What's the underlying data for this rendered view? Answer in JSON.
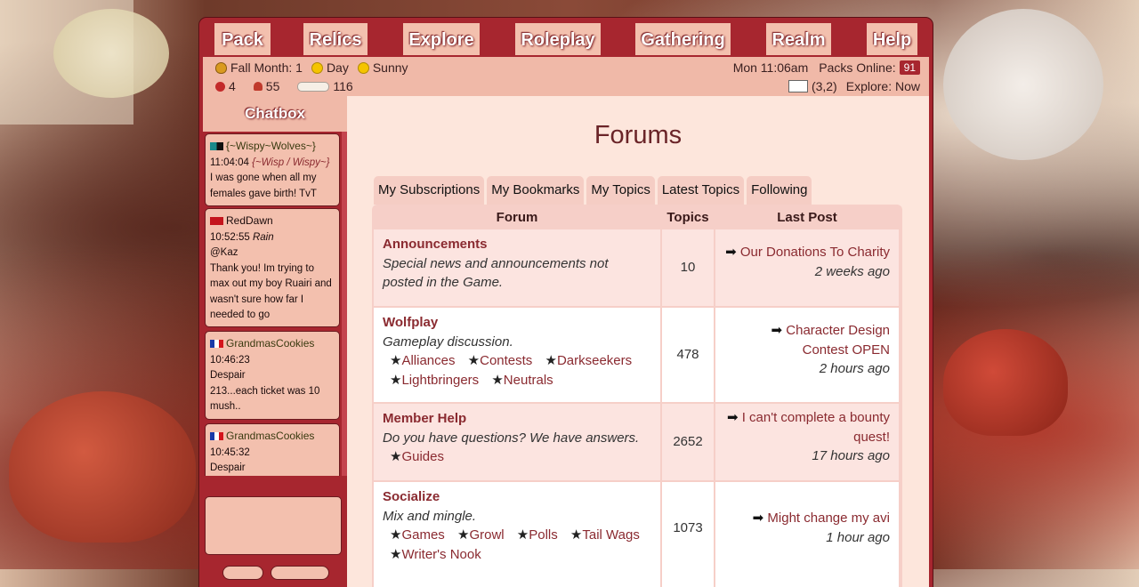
{
  "nav": [
    "Pack",
    "Relics",
    "Explore",
    "Roleplay",
    "Gathering",
    "Realm",
    "Help"
  ],
  "status": {
    "season": "Fall Month: 1",
    "time_of_day": "Day",
    "weather": "Sunny",
    "clock": "Mon 11:06am",
    "packs_online_label": "Packs Online:",
    "packs_online_count": "91",
    "hearts": "4",
    "mushrooms": "55",
    "bones": "116",
    "coords": "(3,2)",
    "explore_label": "Explore: Now"
  },
  "chat": {
    "header": "Chatbox",
    "messages": [
      {
        "user": "{~Wispy~Wolves~}",
        "time": "11:04:04",
        "alias": "{~Wisp / Wispy~}",
        "lines": [
          "I was gone when all my",
          "females gave birth! TvT"
        ]
      },
      {
        "user": "RedDawn",
        "time": "10:52:55",
        "alias": "Rain",
        "lines": [
          "@Kaz",
          "Thank you! Im trying to",
          "max out my boy Ruairi and",
          "wasn't sure how far I",
          "needed to go"
        ]
      },
      {
        "user": "GrandmasCookies",
        "time": "10:46:23",
        "alias": "",
        "lines": [
          "Despair",
          "213...each ticket was 10",
          "mush.."
        ]
      },
      {
        "user": "GrandmasCookies",
        "time": "10:45:32",
        "alias": "",
        "lines": [
          "Despair"
        ]
      }
    ]
  },
  "page": {
    "title": "Forums",
    "tabs": [
      "My Subscriptions",
      "My Bookmarks",
      "My Topics",
      "Latest Topics",
      "Following"
    ],
    "columns": [
      "Forum",
      "Topics",
      "Last Post"
    ],
    "forums": [
      {
        "name": "Announcements",
        "desc": "Special news and announcements not posted in the Game.",
        "subs": [],
        "topics": "10",
        "last_post": "Our Donations To Charity",
        "ago": "2 weeks ago"
      },
      {
        "name": "Wolfplay",
        "desc": "Gameplay discussion.",
        "subs": [
          "Alliances",
          "Contests",
          "Darkseekers",
          "Lightbringers",
          "Neutrals"
        ],
        "topics": "478",
        "last_post": "Character Design Contest OPEN",
        "ago": "2 hours ago"
      },
      {
        "name": "Member Help",
        "desc": "Do you have questions? We have answers.",
        "subs": [
          "Guides"
        ],
        "topics": "2652",
        "last_post": "I can't complete a bounty quest!",
        "ago": "17 hours ago"
      },
      {
        "name": "Socialize",
        "desc": "Mix and mingle.",
        "subs": [
          "Games",
          "Growl",
          "Polls",
          "Tail Wags",
          "Writer's Nook"
        ],
        "topics": "1073",
        "last_post": "Might change my avi",
        "ago": "1 hour ago"
      }
    ]
  },
  "colors": {
    "frame": "#a7262f",
    "panel": "#fde6dc",
    "accent": "#8a2a30"
  }
}
